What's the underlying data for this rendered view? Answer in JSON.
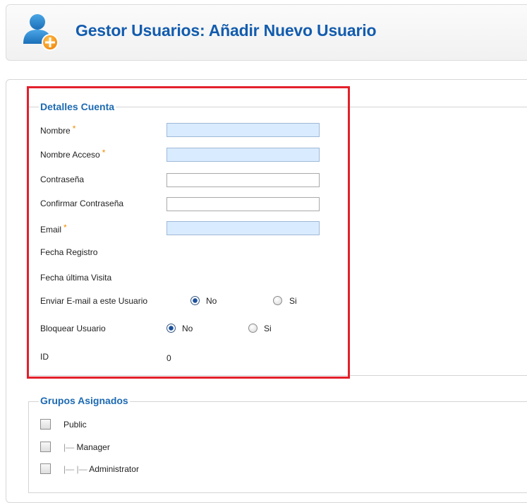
{
  "header": {
    "title": "Gestor Usuarios: Añadir Nuevo Usuario",
    "icon": "user-add-icon"
  },
  "account_details": {
    "legend": "Detalles Cuenta",
    "required_marker": "*",
    "fields": {
      "name": {
        "label": "Nombre",
        "value": "",
        "required": true
      },
      "username": {
        "label": "Nombre Acceso",
        "value": "",
        "required": true
      },
      "password": {
        "label": "Contraseña",
        "value": "",
        "required": false
      },
      "confirm_password": {
        "label": "Confirmar Contraseña",
        "value": "",
        "required": false
      },
      "email": {
        "label": "Email",
        "value": "",
        "required": true
      }
    },
    "register_date": {
      "label": "Fecha Registro"
    },
    "last_visit_date": {
      "label": "Fecha última Visita"
    },
    "send_email": {
      "label": "Enviar E-mail a este Usuario",
      "options": [
        "No",
        "Si"
      ],
      "selected": "No"
    },
    "block_user": {
      "label": "Bloquear Usuario",
      "options": [
        "No",
        "Si"
      ],
      "selected": "No"
    },
    "id": {
      "label": "ID",
      "value": "0"
    }
  },
  "assigned_groups": {
    "legend": "Grupos Asignados",
    "groups": [
      {
        "prefix": "",
        "name": "Public",
        "checked": false
      },
      {
        "prefix": "|— ",
        "name": "Manager",
        "checked": false
      },
      {
        "prefix": "|— |— ",
        "name": "Administrator",
        "checked": false
      }
    ]
  },
  "colors": {
    "title": "#135cae",
    "legend": "#1d6ab2",
    "required_field_bg": "#d9ebff",
    "required_star": "#f28c00",
    "highlight_box": "#e3202b"
  }
}
